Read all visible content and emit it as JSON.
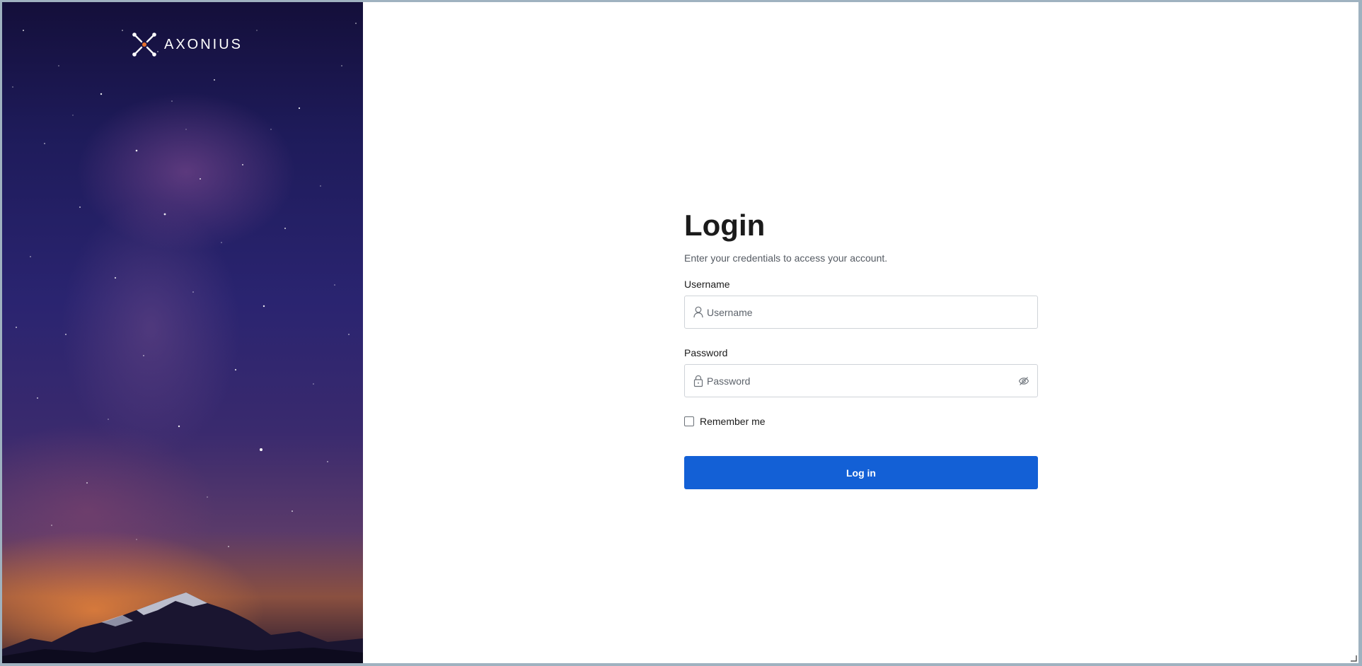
{
  "brand": {
    "name": "AXONIUS",
    "logo_icon": "axonius-x-logo",
    "accent_color": "#e8722c"
  },
  "login": {
    "title": "Login",
    "subtitle": "Enter your credentials to access your account.",
    "username": {
      "label": "Username",
      "placeholder": "Username",
      "value": "",
      "icon": "user-icon"
    },
    "password": {
      "label": "Password",
      "placeholder": "Password",
      "value": "",
      "icon": "lock-icon",
      "toggle_icon": "eye-off-icon"
    },
    "remember": {
      "label": "Remember me",
      "checked": false
    },
    "submit_label": "Log in",
    "submit_color": "#1360d6"
  }
}
